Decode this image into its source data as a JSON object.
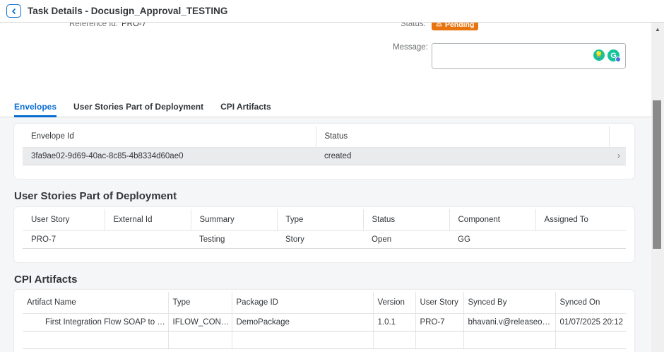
{
  "header": {
    "title": "Task Details - Docusign_Approval_TESTING"
  },
  "details": {
    "reference_label": "Reference Id:",
    "reference_value": "PRO-7",
    "status_label": "Status:",
    "status_value": "Pending",
    "status_color": "#e9730c",
    "message_label": "Message:",
    "message_value": ""
  },
  "tabs": [
    "Envelopes",
    "User Stories Part of Deployment",
    "CPI Artifacts"
  ],
  "envelopes": {
    "columns": [
      "Envelope Id",
      "Status"
    ],
    "rows": [
      {
        "id": "3fa9ae02-9d69-40ac-8c85-4b8334d60ae0",
        "status": "created"
      }
    ]
  },
  "user_stories": {
    "title": "User Stories Part of Deployment",
    "columns": [
      "User Story",
      "External Id",
      "Summary",
      "Type",
      "Status",
      "Component",
      "Assigned To"
    ],
    "rows": [
      [
        "PRO-7",
        "",
        "Testing",
        "Story",
        "Open",
        "GG",
        ""
      ]
    ]
  },
  "cpi": {
    "title": "CPI Artifacts",
    "columns": [
      "Artifact Name",
      "Type",
      "Package ID",
      "Version",
      "User Story",
      "Synced By",
      "Synced On"
    ],
    "rows": [
      [
        "First Integration Flow SOAP to Mai...",
        "IFLOW_CONFI...",
        "DemoPackage",
        "1.0.1",
        "PRO-7",
        "bhavani.v@releaseowl....",
        "01/07/2025 20:12"
      ]
    ]
  },
  "colors": {
    "accent": "#0a6ed1",
    "badge": "#e9730c"
  }
}
